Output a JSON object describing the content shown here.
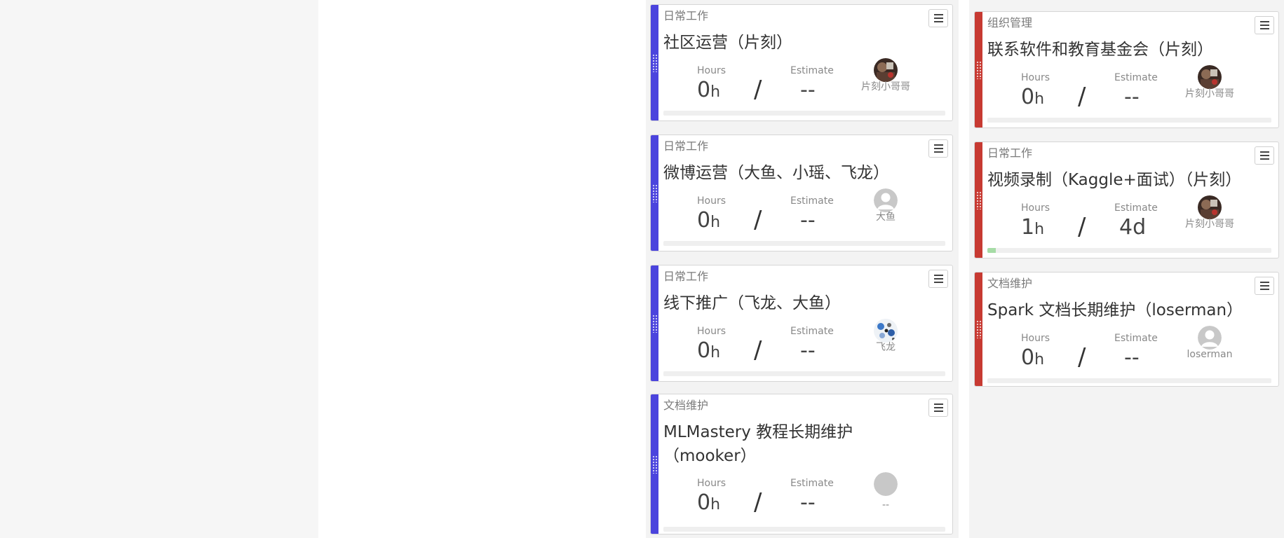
{
  "labels": {
    "hours": "Hours",
    "estimate": "Estimate",
    "hours_unit": "h"
  },
  "colors": {
    "blue_accent": "#4b44dd",
    "red_accent": "#c73a32",
    "progress_fill": "#a6dca6"
  },
  "columns": [
    {
      "cards": [
        {
          "category": "日常工作",
          "title": "社区运营（片刻）",
          "hours": "0",
          "estimate": "--",
          "assignee": "片刻小哥哥",
          "avatar": "photo-avatar",
          "progress": 0
        },
        {
          "category": "日常工作",
          "title": "微博运营（大鱼、小瑶、飞龙）",
          "hours": "0",
          "estimate": "--",
          "assignee": "大鱼",
          "avatar": "default-user-avatar",
          "progress": 0
        },
        {
          "category": "日常工作",
          "title": "线下推广（飞龙、大鱼）",
          "hours": "0",
          "estimate": "--",
          "assignee": "飞龙",
          "avatar": "pattern-avatar",
          "progress": 0
        },
        {
          "category": "文档维护",
          "title": "MLMastery 教程长期维护（mooker）",
          "hours": "0",
          "estimate": "--",
          "assignee": "--",
          "avatar": "blank-avatar",
          "progress": 0
        }
      ]
    },
    {
      "cards": [
        {
          "category": "组织管理",
          "title": "联系软件和教育基金会（片刻）",
          "hours": "0",
          "estimate": "--",
          "assignee": "片刻小哥哥",
          "avatar": "photo-avatar",
          "progress": 0
        },
        {
          "category": "日常工作",
          "title": "视频录制（Kaggle+面试）（片刻）",
          "hours": "1",
          "estimate": "4d",
          "assignee": "片刻小哥哥",
          "avatar": "photo-avatar",
          "progress": 0.03
        },
        {
          "category": "文档维护",
          "title": "Spark 文档长期维护（loserman）",
          "hours": "0",
          "estimate": "--",
          "assignee": "loserman",
          "avatar": "default-user-avatar",
          "progress": 0
        }
      ]
    }
  ]
}
